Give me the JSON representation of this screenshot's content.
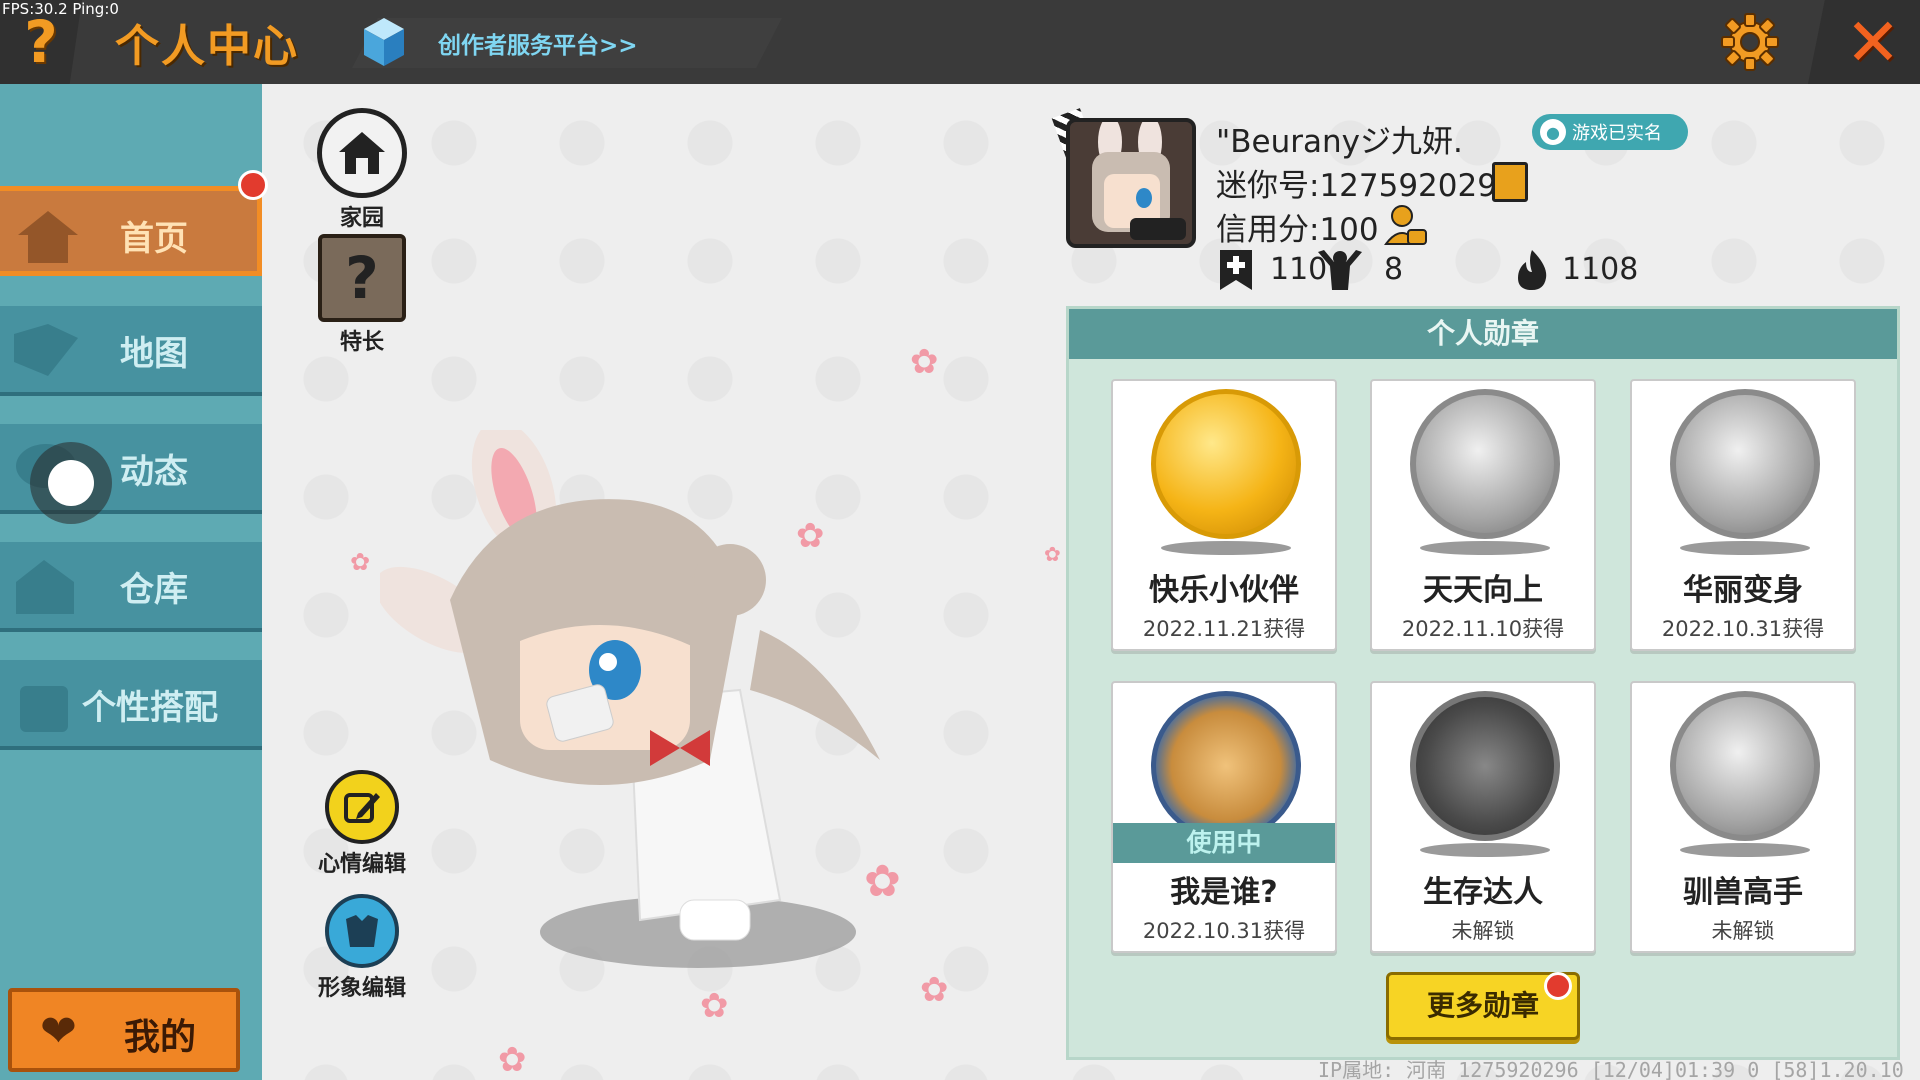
{
  "debug": {
    "fps_text": "FPS:30.2 Ping:0"
  },
  "header": {
    "help_symbol": "?",
    "title": "个人中心",
    "creator_link": "创作者服务平台>>",
    "close_symbol": "✕"
  },
  "sidebar": {
    "items": [
      {
        "label": "首页",
        "icon": "house-icon",
        "active": true
      },
      {
        "label": "地图",
        "icon": "map-icon",
        "active": false
      },
      {
        "label": "动态",
        "icon": "chat-icon",
        "active": false
      },
      {
        "label": "仓库",
        "icon": "warehouse-icon",
        "active": false
      },
      {
        "label": "个性搭配",
        "icon": "outfit-icon",
        "active": false
      }
    ],
    "mine_label": "我的"
  },
  "actions": {
    "home_label": "家园",
    "skill_label": "特长",
    "skill_symbol": "?",
    "mood_label": "心情编辑",
    "look_label": "形象编辑"
  },
  "profile": {
    "nickname": "\"Beuranyジ九妍.",
    "verified_badge": "游戏已实名",
    "mini_id": "迷你号:1275920296",
    "credit": "信用分:100",
    "stats": [
      {
        "icon": "bookmark-plus-icon",
        "value": "110"
      },
      {
        "icon": "cheer-icon",
        "value": "8"
      },
      {
        "icon": "fire-icon",
        "value": "1108"
      }
    ]
  },
  "medals": {
    "header": "个人勋章",
    "items": [
      {
        "name": "快乐小伙伴",
        "status": "2022.11.21获得",
        "style": "gold",
        "in_use": false
      },
      {
        "name": "天天向上",
        "status": "2022.11.10获得",
        "style": "stone",
        "in_use": false
      },
      {
        "name": "华丽变身",
        "status": "2022.10.31获得",
        "style": "stone",
        "in_use": false
      },
      {
        "name": "我是谁?",
        "status": "2022.10.31获得",
        "style": "blue-ring",
        "in_use": true
      },
      {
        "name": "生存达人",
        "status": "未解锁",
        "style": "dark-stone",
        "in_use": false
      },
      {
        "name": "驯兽高手",
        "status": "未解锁",
        "style": "stone",
        "in_use": false
      }
    ],
    "in_use_label": "使用中",
    "more_button": "更多勋章"
  },
  "footer": {
    "ip_label": "IP属地: 河南",
    "user_id": "1275920296",
    "timestamp": "[12/04]01:39 0",
    "session": "[58]1.20.10"
  },
  "colors": {
    "accent_orange": "#f29b23",
    "sidebar_teal": "#4792a0",
    "panel_green": "#cfe6db",
    "header_teal": "#5a9a99",
    "button_yellow": "#f7d424"
  }
}
